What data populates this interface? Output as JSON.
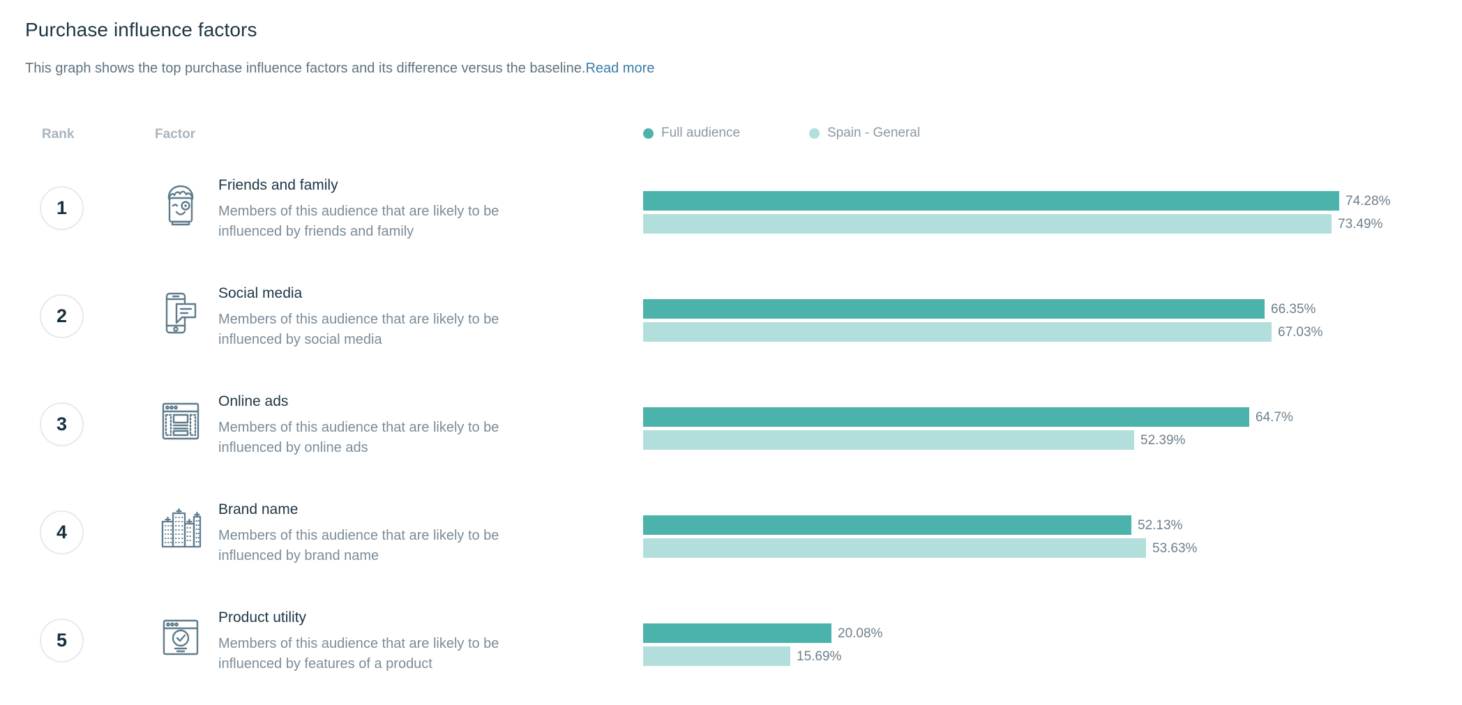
{
  "header": {
    "title": "Purchase influence factors",
    "subtitle": "This graph shows the top purchase influence factors and its difference versus the baseline.",
    "read_more": "Read more"
  },
  "columns": {
    "rank": "Rank",
    "factor": "Factor"
  },
  "legend": [
    {
      "label": "Full audience",
      "color": "#4bb3ab"
    },
    {
      "label": "Spain - General",
      "color": "#b2dedb"
    }
  ],
  "colors": {
    "primary_series": "#4bb3ab",
    "secondary_series": "#b2dedb",
    "title": "#1d3644",
    "muted_text": "#7b8c99",
    "column_header": "#a9b4bd",
    "link": "#3a7ca8",
    "icon_stroke": "#5f7b8c",
    "rank_border": "#e6e9ec"
  },
  "chart_data": {
    "type": "bar",
    "title": "Purchase influence factors",
    "orientation": "horizontal",
    "xlabel": "",
    "ylabel": "",
    "xlim": [
      0,
      74.28
    ],
    "grid": false,
    "legend_position": "top-right",
    "value_suffix": "%",
    "categories": [
      "Friends and family",
      "Social media",
      "Online ads",
      "Brand name",
      "Product utility"
    ],
    "series": [
      {
        "name": "Full audience",
        "color": "#4bb3ab",
        "values": [
          74.28,
          66.35,
          64.7,
          52.13,
          20.08
        ]
      },
      {
        "name": "Spain - General",
        "color": "#b2dedb",
        "values": [
          73.49,
          67.03,
          52.39,
          53.63,
          15.69
        ]
      }
    ]
  },
  "rows": [
    {
      "rank": "1",
      "icon": "person-wink-icon",
      "name": "Friends and family",
      "description": "Members of this audience that are likely to be influenced by friends and family",
      "primary_value": "74.28%",
      "primary_pct": 74.28,
      "secondary_value": "73.49%",
      "secondary_pct": 73.49
    },
    {
      "rank": "2",
      "icon": "mobile-chat-icon",
      "name": "Social media",
      "description": "Members of this audience that are likely to be influenced by social media",
      "primary_value": "66.35%",
      "primary_pct": 66.35,
      "secondary_value": "67.03%",
      "secondary_pct": 67.03
    },
    {
      "rank": "3",
      "icon": "browser-ads-icon",
      "name": "Online ads",
      "description": "Members of this audience that are likely to be influenced by online ads",
      "primary_value": "64.7%",
      "primary_pct": 64.7,
      "secondary_value": "52.39%",
      "secondary_pct": 52.39
    },
    {
      "rank": "4",
      "icon": "city-buildings-icon",
      "name": "Brand name",
      "description": "Members of this audience that are likely to be influenced by brand name",
      "primary_value": "52.13%",
      "primary_pct": 52.13,
      "secondary_value": "53.63%",
      "secondary_pct": 53.63
    },
    {
      "rank": "5",
      "icon": "browser-check-icon",
      "name": "Product utility",
      "description": "Members of this audience that are likely to be influenced by features of a product",
      "primary_value": "20.08%",
      "primary_pct": 20.08,
      "secondary_value": "15.69%",
      "secondary_pct": 15.69
    }
  ]
}
